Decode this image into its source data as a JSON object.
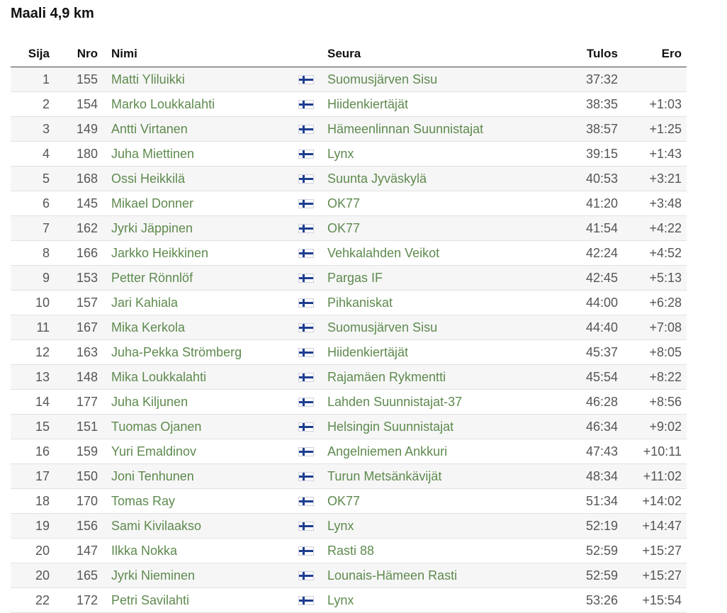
{
  "title": "Maali 4,9 km",
  "columns": {
    "sija": "Sija",
    "nro": "Nro",
    "nimi": "Nimi",
    "seura": "Seura",
    "tulos": "Tulos",
    "ero": "Ero"
  },
  "flag_icon": "finland-flag-icon",
  "colors": {
    "link": "#5e8a4e",
    "row_stripe": "#f6f6f6",
    "flag_blue": "#1d3d8f"
  },
  "rows": [
    {
      "sija": "1",
      "nro": "155",
      "nimi": "Matti Yliluikki",
      "seura": "Suomusjärven Sisu",
      "tulos": "37:32",
      "ero": ""
    },
    {
      "sija": "2",
      "nro": "154",
      "nimi": "Marko Loukkalahti",
      "seura": "Hiidenkiertäjät",
      "tulos": "38:35",
      "ero": "+1:03"
    },
    {
      "sija": "3",
      "nro": "149",
      "nimi": "Antti Virtanen",
      "seura": "Hämeenlinnan Suunnistajat",
      "tulos": "38:57",
      "ero": "+1:25"
    },
    {
      "sija": "4",
      "nro": "180",
      "nimi": "Juha Miettinen",
      "seura": "Lynx",
      "tulos": "39:15",
      "ero": "+1:43"
    },
    {
      "sija": "5",
      "nro": "168",
      "nimi": "Ossi Heikkilä",
      "seura": "Suunta Jyväskylä",
      "tulos": "40:53",
      "ero": "+3:21"
    },
    {
      "sija": "6",
      "nro": "145",
      "nimi": "Mikael Donner",
      "seura": "OK77",
      "tulos": "41:20",
      "ero": "+3:48"
    },
    {
      "sija": "7",
      "nro": "162",
      "nimi": "Jyrki Jäppinen",
      "seura": "OK77",
      "tulos": "41:54",
      "ero": "+4:22"
    },
    {
      "sija": "8",
      "nro": "166",
      "nimi": "Jarkko Heikkinen",
      "seura": "Vehkalahden Veikot",
      "tulos": "42:24",
      "ero": "+4:52"
    },
    {
      "sija": "9",
      "nro": "153",
      "nimi": "Petter Rönnlöf",
      "seura": "Pargas IF",
      "tulos": "42:45",
      "ero": "+5:13"
    },
    {
      "sija": "10",
      "nro": "157",
      "nimi": "Jari Kahiala",
      "seura": "Pihkaniskat",
      "tulos": "44:00",
      "ero": "+6:28"
    },
    {
      "sija": "11",
      "nro": "167",
      "nimi": "Mika Kerkola",
      "seura": "Suomusjärven Sisu",
      "tulos": "44:40",
      "ero": "+7:08"
    },
    {
      "sija": "12",
      "nro": "163",
      "nimi": "Juha-Pekka Strömberg",
      "seura": "Hiidenkiertäjät",
      "tulos": "45:37",
      "ero": "+8:05"
    },
    {
      "sija": "13",
      "nro": "148",
      "nimi": "Mika Loukkalahti",
      "seura": "Rajamäen Rykmentti",
      "tulos": "45:54",
      "ero": "+8:22"
    },
    {
      "sija": "14",
      "nro": "177",
      "nimi": "Juha Kiljunen",
      "seura": "Lahden Suunnistajat-37",
      "tulos": "46:28",
      "ero": "+8:56"
    },
    {
      "sija": "15",
      "nro": "151",
      "nimi": "Tuomas Ojanen",
      "seura": "Helsingin Suunnistajat",
      "tulos": "46:34",
      "ero": "+9:02"
    },
    {
      "sija": "16",
      "nro": "159",
      "nimi": "Yuri Emaldinov",
      "seura": "Angelniemen Ankkuri",
      "tulos": "47:43",
      "ero": "+10:11"
    },
    {
      "sija": "17",
      "nro": "150",
      "nimi": "Joni Tenhunen",
      "seura": "Turun Metsänkävijät",
      "tulos": "48:34",
      "ero": "+11:02"
    },
    {
      "sija": "18",
      "nro": "170",
      "nimi": "Tomas Ray",
      "seura": "OK77",
      "tulos": "51:34",
      "ero": "+14:02"
    },
    {
      "sija": "19",
      "nro": "156",
      "nimi": "Sami Kivilaakso",
      "seura": "Lynx",
      "tulos": "52:19",
      "ero": "+14:47"
    },
    {
      "sija": "20",
      "nro": "147",
      "nimi": "Ilkka Nokka",
      "seura": "Rasti 88",
      "tulos": "52:59",
      "ero": "+15:27"
    },
    {
      "sija": "20",
      "nro": "165",
      "nimi": "Jyrki Nieminen",
      "seura": "Lounais-Hämeen Rasti",
      "tulos": "52:59",
      "ero": "+15:27"
    },
    {
      "sija": "22",
      "nro": "172",
      "nimi": "Petri Savilahti",
      "seura": "Lynx",
      "tulos": "53:26",
      "ero": "+15:54"
    }
  ]
}
